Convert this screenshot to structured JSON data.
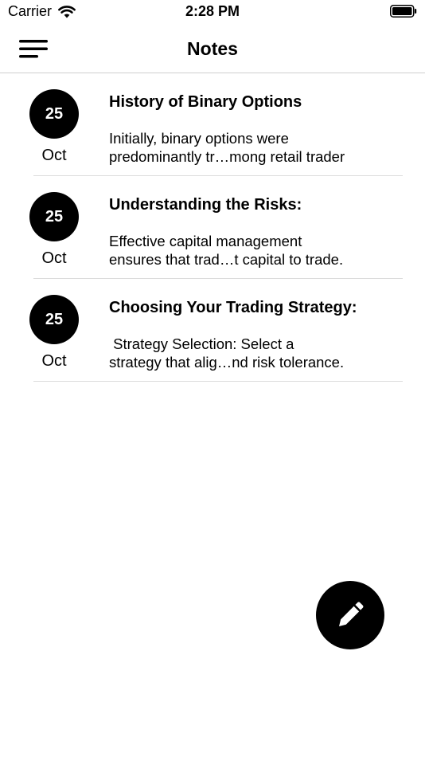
{
  "status_bar": {
    "carrier": "Carrier",
    "time": "2:28 PM"
  },
  "nav": {
    "title": "Notes"
  },
  "notes": [
    {
      "day": "25",
      "month": "Oct",
      "title": "History of Binary Options",
      "preview_line1": "Initially, binary options were",
      "preview_line2": "predominantly tr…mong retail trader"
    },
    {
      "day": "25",
      "month": "Oct",
      "title": "Understanding the Risks:",
      "preview_line1": "Effective capital management",
      "preview_line2": "ensures that trad…t capital to trade."
    },
    {
      "day": "25",
      "month": "Oct",
      "title": "Choosing Your Trading Strategy:",
      "preview_line1": " Strategy Selection: Select a",
      "preview_line2": "strategy that alig…nd risk tolerance."
    }
  ],
  "icons": {
    "menu": "menu-icon",
    "compose": "pencil-icon",
    "wifi": "wifi-icon",
    "battery": "battery-icon"
  },
  "colors": {
    "accent": "#000000",
    "background": "#ffffff",
    "divider": "#dcdcdc"
  }
}
